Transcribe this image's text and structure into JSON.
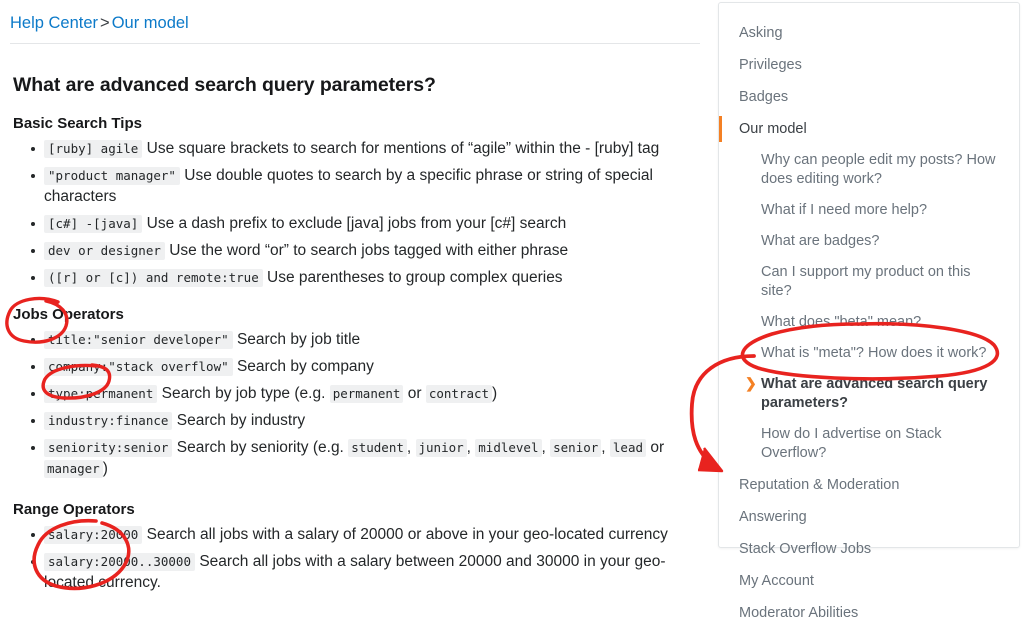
{
  "breadcrumb": {
    "root": "Help Center",
    "separator": ">",
    "current": "Our model"
  },
  "page_title": "What are advanced search query parameters?",
  "sections": [
    {
      "heading": "Basic Search Tips",
      "items": [
        {
          "code": "[ruby] agile",
          "text": "Use square brackets to search for mentions of “agile” within the - [ruby] tag"
        },
        {
          "code": "\"product manager\"",
          "text": "Use double quotes to search by a specific phrase or string of special characters"
        },
        {
          "code": "[c#] -[java]",
          "text": "Use a dash prefix to exclude [java] jobs from your [c#] search"
        },
        {
          "code": "dev or designer",
          "text": "Use the word “or” to search jobs tagged with either phrase"
        },
        {
          "code": "([r] or [c]) and remote:true",
          "text": "Use parentheses to group complex queries"
        }
      ]
    },
    {
      "heading": "Jobs Operators",
      "items": [
        {
          "code": "title:\"senior developer\"",
          "text": "Search by job title"
        },
        {
          "code": "company:\"stack overflow\"",
          "text": "Search by company"
        },
        {
          "code": "type:permanent",
          "text": "Search by job type (e.g. ",
          "inline_codes": [
            "permanent",
            "contract"
          ],
          "mid": " or ",
          "tail": ")"
        },
        {
          "code": "industry:finance",
          "text": "Search by industry"
        },
        {
          "code": "seniority:senior",
          "text": "Search by seniority (e.g. ",
          "inline_codes": [
            "student",
            "junior",
            "midlevel",
            "senior",
            "lead",
            "manager"
          ],
          "mid": " or ",
          "tail": ")"
        }
      ]
    },
    {
      "heading": "Range Operators",
      "items": [
        {
          "code": "salary:20000",
          "text": "Search all jobs with a salary of 20000 or above in your geo-located currency"
        },
        {
          "code": "salary:20000..30000",
          "text": "Search all jobs with a salary between 20000 and 30000 in your geo-located currency."
        }
      ]
    }
  ],
  "sidebar": {
    "items": [
      {
        "label": "Asking",
        "type": "top",
        "active": false
      },
      {
        "label": "Privileges",
        "type": "top",
        "active": false
      },
      {
        "label": "Badges",
        "type": "top",
        "active": false
      },
      {
        "label": "Our model",
        "type": "top",
        "active": true
      },
      {
        "label": "Why can people edit my posts? How does editing work?",
        "type": "sub",
        "current": false
      },
      {
        "label": "What if I need more help?",
        "type": "sub",
        "current": false
      },
      {
        "label": "What are badges?",
        "type": "sub",
        "current": false
      },
      {
        "label": "Can I support my product on this site?",
        "type": "sub",
        "current": false
      },
      {
        "label": "What does \"beta\" mean?",
        "type": "sub",
        "current": false
      },
      {
        "label": "What is \"meta\"? How does it work?",
        "type": "sub",
        "current": false
      },
      {
        "label": "What are advanced search query parameters?",
        "type": "sub",
        "current": true,
        "icon": "chevron-right-icon",
        "icon_glyph": "❯"
      },
      {
        "label": "How do I advertise on Stack Overflow?",
        "type": "sub",
        "current": false
      },
      {
        "label": "Reputation & Moderation",
        "type": "top",
        "active": false
      },
      {
        "label": "Answering",
        "type": "top",
        "active": false
      },
      {
        "label": "Stack Overflow Jobs",
        "type": "top",
        "active": false
      },
      {
        "label": "My Account",
        "type": "top",
        "active": false
      },
      {
        "label": "Moderator Abilities",
        "type": "top",
        "active": false
      }
    ]
  },
  "colors": {
    "link": "#0c7ac9",
    "accent_orange": "#f48024",
    "annotation_red": "#e8231f",
    "code_bg": "#eff0f1",
    "muted_text": "#6a737c"
  },
  "annotations": [
    {
      "name": "circle-jobs",
      "shape": "ellipse",
      "target": "Jobs"
    },
    {
      "name": "circle-company",
      "shape": "ellipse",
      "target": "company"
    },
    {
      "name": "circle-salary",
      "shape": "ellipse",
      "target": "salary:20000"
    },
    {
      "name": "ellipse-sidebar-current",
      "shape": "ellipse",
      "target": "What are advanced search query parameters?"
    },
    {
      "name": "arrow-to-stack-overflow-jobs",
      "shape": "arrow",
      "target": "Stack Overflow Jobs"
    }
  ]
}
